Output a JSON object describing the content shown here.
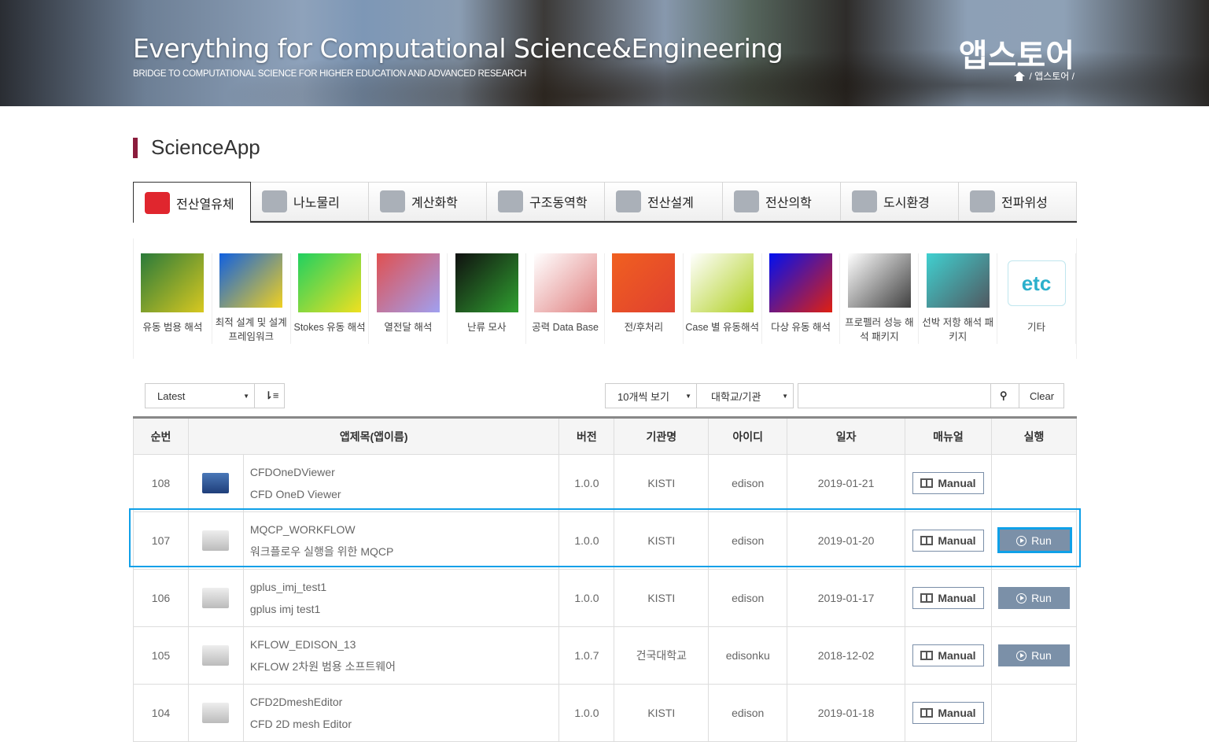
{
  "header": {
    "title": "Everything for Computational Science&Engineering",
    "subtitle": "BRIDGE TO COMPUTATIONAL SCIENCE FOR HIGHER EDUCATION AND ADVANCED RESEARCH",
    "page_name": "앱스토어",
    "breadcrumb": "/ 앱스토어 /"
  },
  "section": {
    "title": "ScienceApp"
  },
  "tabs": [
    {
      "label": "전산열유체",
      "active": true
    },
    {
      "label": "나노물리"
    },
    {
      "label": "계산화학"
    },
    {
      "label": "구조동역학"
    },
    {
      "label": "전산설계"
    },
    {
      "label": "전산의학"
    },
    {
      "label": "도시환경"
    },
    {
      "label": "전파위성"
    }
  ],
  "categories": [
    {
      "label": "유동 범용 해석",
      "colors": [
        "#2a7a3a",
        "#d8c820"
      ]
    },
    {
      "label": "최적 설계 및 설계 프레임워크",
      "colors": [
        "#1060e0",
        "#f0d020"
      ]
    },
    {
      "label": "Stokes 유동 해석",
      "colors": [
        "#20d060",
        "#f0e020"
      ]
    },
    {
      "label": "열전달 해석",
      "colors": [
        "#e05050",
        "#a0a0f0"
      ]
    },
    {
      "label": "난류 모사",
      "colors": [
        "#101010",
        "#30a030"
      ]
    },
    {
      "label": "공력 Data Base",
      "colors": [
        "#ffffff",
        "#e08080"
      ]
    },
    {
      "label": "전/후처리",
      "colors": [
        "#f06020",
        "#e04030"
      ]
    },
    {
      "label": "Case 별 유동해석",
      "colors": [
        "#ffffff",
        "#b0d020"
      ]
    },
    {
      "label": "다상 유동 해석",
      "colors": [
        "#0010f0",
        "#e02010"
      ]
    },
    {
      "label": "프로펠러 성능 해석 패키지",
      "colors": [
        "#ffffff",
        "#404040"
      ]
    },
    {
      "label": "선박 저항 해석 패키지",
      "colors": [
        "#40d0d0",
        "#505860"
      ]
    },
    {
      "label": "기타",
      "etc": "etc"
    }
  ],
  "toolbar": {
    "sort": "Latest",
    "page_size": "10개씩 보기",
    "org_filter": "대학교/기관",
    "search_value": "",
    "clear": "Clear"
  },
  "table": {
    "headers": [
      "순번",
      "앱제목(앱이름)",
      "버전",
      "기관명",
      "아이디",
      "일자",
      "매뉴얼",
      "실행"
    ],
    "manual_label": "Manual",
    "run_label": "Run",
    "rows": [
      {
        "no": "108",
        "name": "CFDOneDViewer",
        "desc": "CFD OneD Viewer",
        "version": "1.0.0",
        "org": "KISTI",
        "id": "edison",
        "date": "2019-01-21",
        "run": false
      },
      {
        "no": "107",
        "name": "MQCP_WORKFLOW",
        "desc": "워크플로우 실행을 위한 MQCP",
        "version": "1.0.0",
        "org": "KISTI",
        "id": "edison",
        "date": "2019-01-20",
        "run": true
      },
      {
        "no": "106",
        "name": "gplus_imj_test1",
        "desc": "gplus imj test1",
        "version": "1.0.0",
        "org": "KISTI",
        "id": "edison",
        "date": "2019-01-17",
        "run": true
      },
      {
        "no": "105",
        "name": "KFLOW_EDISON_13",
        "desc": "KFLOW 2차원 범용 소프트웨어",
        "version": "1.0.7",
        "org": "건국대학교",
        "id": "edisonku",
        "date": "2018-12-02",
        "run": true
      },
      {
        "no": "104",
        "name": "CFD2DmeshEditor",
        "desc": "CFD 2D mesh Editor",
        "version": "1.0.0",
        "org": "KISTI",
        "id": "edison",
        "date": "2019-01-18",
        "run": false
      }
    ]
  }
}
